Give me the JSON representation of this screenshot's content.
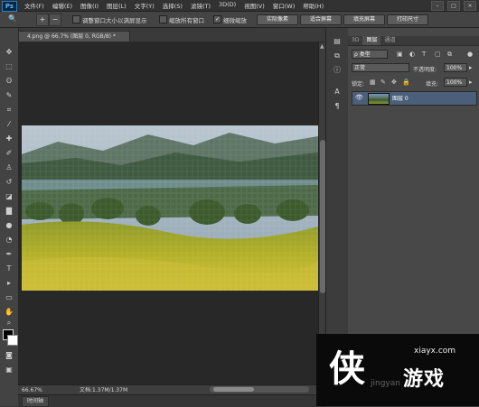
{
  "app": {
    "logo": "Ps",
    "menu": [
      "文件(F)",
      "编辑(E)",
      "图像(I)",
      "图层(L)",
      "文字(Y)",
      "选择(S)",
      "滤镜(T)",
      "3D(D)",
      "视图(V)",
      "窗口(W)",
      "帮助(H)"
    ],
    "window_buttons": [
      "–",
      "□",
      "×"
    ]
  },
  "options_bar": {
    "resize_windows": "调整窗口大小以满屏显示",
    "zoom_all_windows": "缩放所有窗口",
    "scrubby_zoom": "细微缩放",
    "actual_pixels": "实际像素",
    "fit_screen": "适合屏幕",
    "fill_screen": "填充屏幕",
    "print_size": "打印尺寸"
  },
  "document": {
    "tab_title": "4.png @ 66.7% (图层 0, RGB/8) *"
  },
  "status": {
    "zoom": "66.67%",
    "doc_info": "文档:1.37M/1.37M"
  },
  "bottom_panel": {
    "timeline": "时间轴"
  },
  "layers_panel": {
    "tabs": [
      "3D",
      "图层",
      "通道"
    ],
    "active_tab": "图层",
    "filter_kind": "ρ 类型",
    "blend_mode": "正常",
    "opacity_label": "不透明度:",
    "opacity_value": "100%",
    "lock_label": "锁定:",
    "fill_label": "填充:",
    "fill_value": "100%",
    "layers": [
      {
        "name": "图层 0",
        "visible": true
      }
    ]
  },
  "watermark": {
    "site": "xiayx.com",
    "logo_char": "侠",
    "logo_text": "游戏",
    "faint": "jingyan"
  },
  "colors": {
    "foreground": "#000000",
    "background": "#ffffff",
    "selected_layer": "#4b5f7a"
  }
}
